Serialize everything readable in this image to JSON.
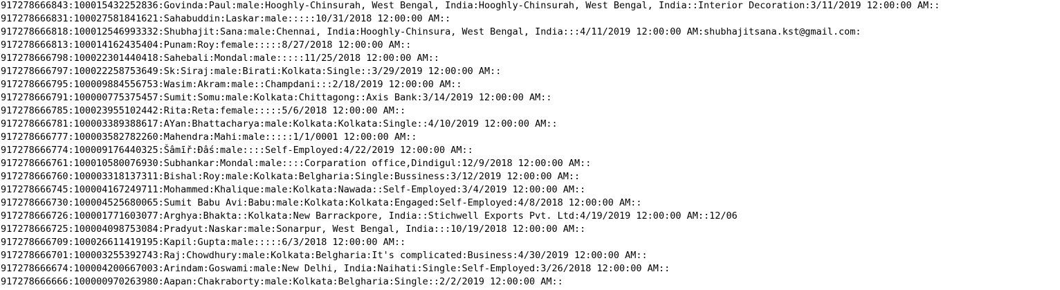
{
  "document": {
    "lines": [
      "917278666843:100015432252836:Govinda:Paul:male:Hooghly-Chinsurah, West Bengal, India:Hooghly-Chinsurah, West Bengal, India::Interior Decoration:3/11/2019 12:00:00 AM::",
      "917278666831:100027581841621:Sahabuddin:Laskar:male:::::10/31/2018 12:00:00 AM::",
      "917278666818:100012546993332:Shubhajit:Sana:male:Chennai, India:Hooghly-Chinsura, West Bengal, India:::4/11/2019 12:00:00 AM:shubhajitsana.kst@gmail.com:",
      "917278666813:100014162435404:Punam:Roy:female:::::8/27/2018 12:00:00 AM::",
      "917278666798:100022301440418:Sahebali:Mondal:male:::::11/25/2018 12:00:00 AM::",
      "917278666797:100022258753649:Sk:Siraj:male:Birati:Kolkata:Single::3/29/2019 12:00:00 AM::",
      "917278666795:100009884556753:Wasim:Akram:male::Champdani:::2/18/2019 12:00:00 AM::",
      "917278666791:100000775375457:Sumit:Somu:male:Kolkata:Chittagong::Axis Bank:3/14/2019 12:00:00 AM::",
      "917278666785:100023955102442:Rita:Reta:female:::::5/6/2018 12:00:00 AM::",
      "917278666781:100003389388617:AYan:Bhattacharya:male:Kolkata:Kolkata:Single::4/10/2019 12:00:00 AM::",
      "917278666777:100003582782260:Mahendra:Mahi:male:::::1/1/0001 12:00:00 AM::",
      "917278666774:100009176440325:Šâmīř:Ðâś:male::::Self-Employed:4/22/2019 12:00:00 AM::",
      "917278666761:100010580076930:Subhankar:Mondal:male::::Corparation office,Dindigul:12/9/2018 12:00:00 AM::",
      "917278666760:100003318137311:Bishal:Roy:male:Kolkata:Belgharia:Single:Bussiness:3/12/2019 12:00:00 AM::",
      "917278666745:100004167249711:Mohammed:Khalique:male:Kolkata:Nawada::Self-Employed:3/4/2019 12:00:00 AM::",
      "917278666730:100004525680065:Sumit Babu Avi:Babu:male:Kolkata:Kolkata:Engaged:Self-Employed:4/8/2018 12:00:00 AM::",
      "917278666726:100001771603077:Arghya:Bhakta::Kolkata:New Barrackpore, India::Stichwell Exports Pvt. Ltd:4/19/2019 12:00:00 AM::12/06",
      "917278666725:100004098753084:Pradyut:Naskar:male:Sonarpur, West Bengal, India:::10/19/2018 12:00:00 AM::",
      "917278666709:100026611419195:Kapil:Gupta:male:::::6/3/2018 12:00:00 AM::",
      "917278666701:100003255392743:Raj:Chowdhury:male:Kolkata:Belgharia:It's complicated:Business:4/30/2019 12:00:00 AM::",
      "917278666674:100004200667003:Arindam:Goswami:male:New Delhi, India:Naihati:Single:Self-Employed:3/26/2018 12:00:00 AM::",
      "917278666666:100000970263980:Aapan:Chakraborty:male:Kolkata:Belgharia:Single::2/2/2019 12:00:00 AM::"
    ]
  }
}
